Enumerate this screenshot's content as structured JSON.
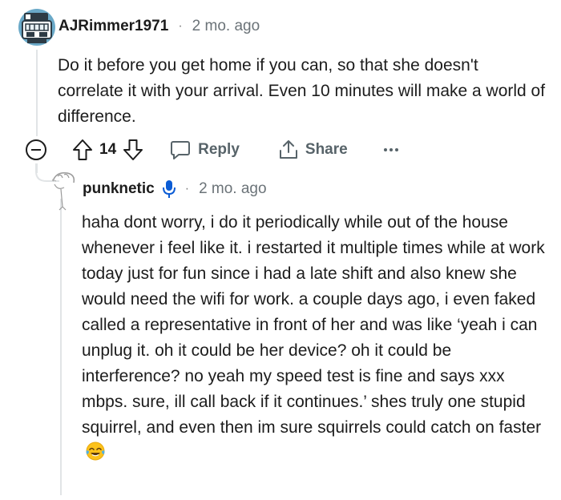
{
  "parent_comment": {
    "username": "AJRimmer1971",
    "separator": "·",
    "time": "2 mo. ago",
    "body": "Do it before you get home if you can, so that she doesn't correlate it with your arrival. Even 10 minutes will make a world of difference.",
    "avatar_icon": "robot-avatar-icon",
    "actions": {
      "collapse_icon": "collapse-minus-icon",
      "upvote_icon": "upvote-arrow-icon",
      "score": "14",
      "downvote_icon": "downvote-arrow-icon",
      "reply_label": "Reply",
      "share_label": "Share",
      "more_icon": "more-dots-icon"
    }
  },
  "reply_comment": {
    "username": "punknetic",
    "badge_icon": "microphone-icon",
    "separator": "·",
    "time": "2 mo. ago",
    "body": "haha dont worry, i do it periodically while out of the house whenever i feel like it. i restarted it multiple times while at work today just for fun since i had a late shift and also knew she would need the wifi for work. a couple days ago, i even faked called a representative in front of her and was like ‘yeah i can unplug it. oh it could be her device? oh it could be interference? no yeah my speed test is fine and says xxx mbps. sure, ill call back if it continues.’ shes truly one stupid squirrel, and even then im sure squirrels could catch on faster",
    "trailing_emoji": "tears-of-joy-emoji-icon",
    "avatar_icon": "sketch-avatar-icon"
  },
  "colors": {
    "text": "#1c1c1c",
    "meta": "#6b7378",
    "action": "#576369",
    "thread_line": "#e1e4e6",
    "mic_badge": "#0b5cd5"
  }
}
